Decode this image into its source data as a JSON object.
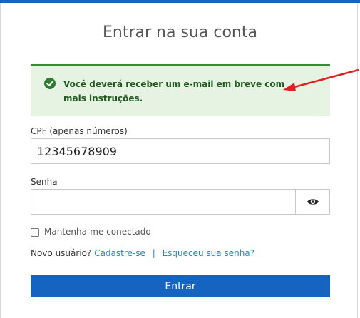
{
  "page": {
    "title": "Entrar na sua conta"
  },
  "alert": {
    "message": "Você deverá receber um e-mail em breve com mais instruções.",
    "icon": "check-circle-icon",
    "color": "#1f5b1f",
    "background": "#e6f2e2"
  },
  "annotation": {
    "arrow_color": "#e02020"
  },
  "form": {
    "cpf_label": "CPF (apenas números)",
    "cpf_value": "12345678909",
    "password_label": "Senha",
    "password_value": "",
    "remember_label": "Mantenha-me conectado",
    "new_user_text": "Novo usuário?",
    "register_link": "Cadastre-se",
    "separator": "|",
    "forgot_link": "Esqueceu sua senha?",
    "submit_label": "Entrar"
  },
  "colors": {
    "accent": "#1565c0",
    "link": "#1e88b6"
  }
}
